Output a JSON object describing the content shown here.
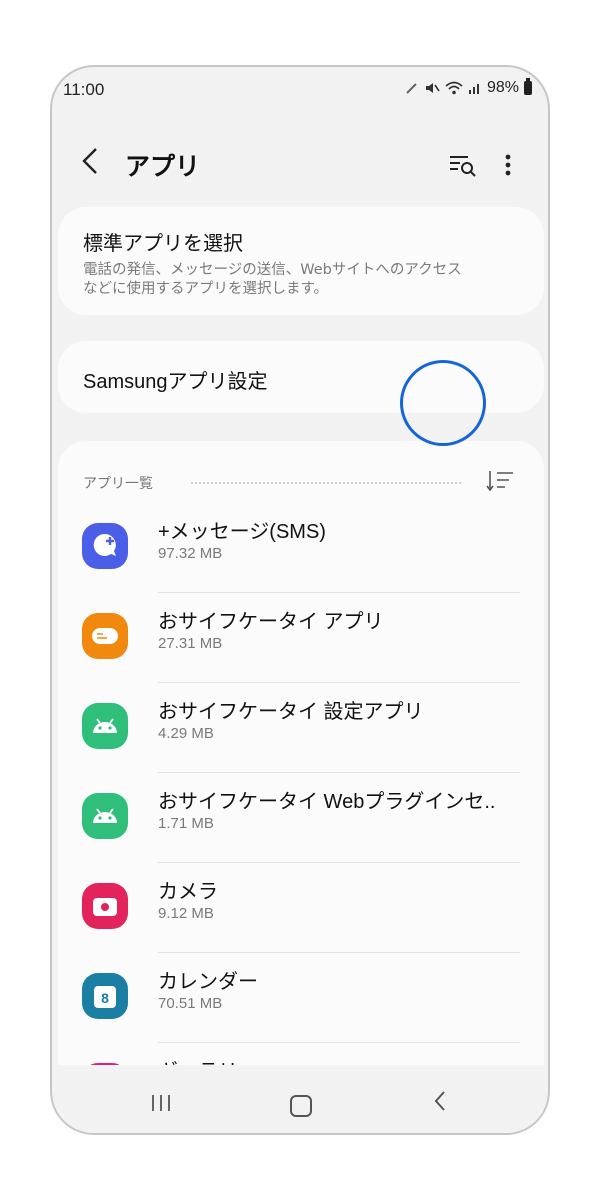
{
  "status": {
    "time": "11:00",
    "battery": "98%"
  },
  "header": {
    "title": "アプリ"
  },
  "default_apps": {
    "title": "標準アプリを選択",
    "description_line1": "電話の発信、メッセージの送信、Webサイトへのアクセス",
    "description_line2": "などに使用するアプリを選択します。"
  },
  "samsung_settings": {
    "title": "Samsungアプリ設定"
  },
  "app_list": {
    "header": "アプリ一覧",
    "apps": [
      {
        "name": "+メッセージ(SMS)",
        "size": "97.32 MB",
        "icon": "message-plus-icon",
        "color": "#4b5ee8"
      },
      {
        "name": "おサイフケータイ アプリ",
        "size": "27.31 MB",
        "icon": "osaifu-keitai-icon",
        "color": "#f0890e"
      },
      {
        "name": "おサイフケータイ 設定アプリ",
        "size": "4.29 MB",
        "icon": "android-icon",
        "color": "#2fbf7a"
      },
      {
        "name": "おサイフケータイ Webプラグインセ..",
        "size": "1.71 MB",
        "icon": "android-icon",
        "color": "#2fbf7a"
      },
      {
        "name": "カメラ",
        "size": "9.12 MB",
        "icon": "camera-icon",
        "color": "#e3245c"
      },
      {
        "name": "カレンダー",
        "size": "70.51 MB",
        "icon": "calendar-icon",
        "color": "#1a7fa3"
      },
      {
        "name": "ギャラリー",
        "size": "",
        "icon": "gallery-icon",
        "color": "#e0207a"
      }
    ]
  },
  "colors": {
    "highlight_circle": "#1565d8"
  }
}
